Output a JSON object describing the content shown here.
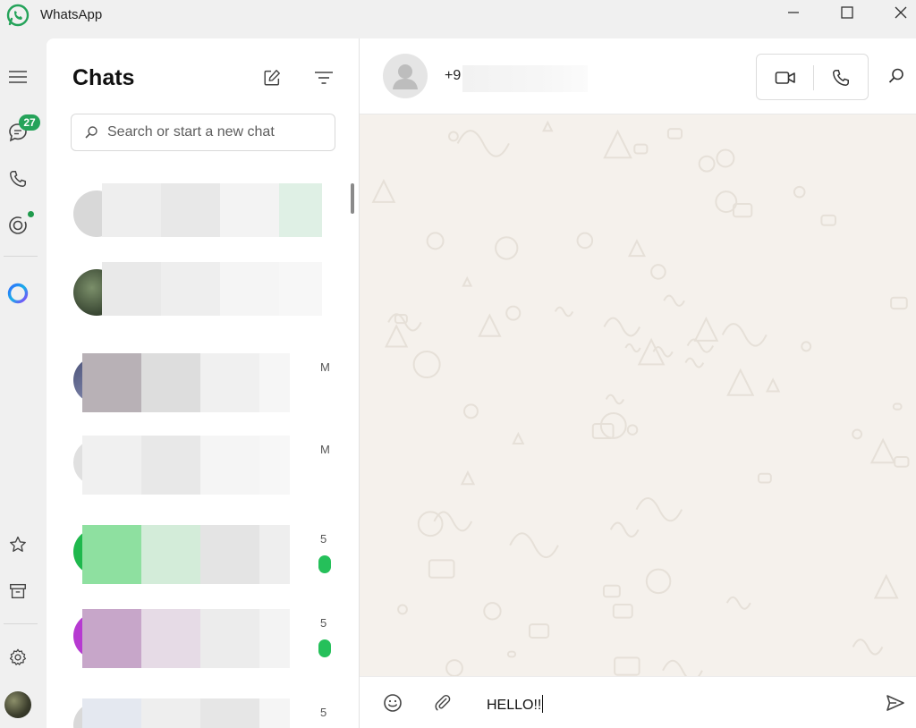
{
  "app": {
    "title": "WhatsApp"
  },
  "window": {
    "minimize": "—",
    "maximize": "☐",
    "close": "✕"
  },
  "rail": {
    "chats_badge": "27"
  },
  "chat_list": {
    "title": "Chats",
    "search_placeholder": "Search or start a new chat",
    "rows": [
      {
        "time": "",
        "unread": false
      },
      {
        "time": "",
        "unread": false
      },
      {
        "time": "M",
        "unread": false
      },
      {
        "time": "M",
        "unread": false
      },
      {
        "time": "5",
        "unread": true
      },
      {
        "time": "5",
        "unread": true
      },
      {
        "time": "5",
        "unread": false
      }
    ]
  },
  "conversation": {
    "contact_prefix": "+9",
    "composer_text": "HELLO!!"
  },
  "colors": {
    "accent": "#25a35a",
    "wallpaper": "#f5f1ec",
    "panel": "#ffffff"
  }
}
